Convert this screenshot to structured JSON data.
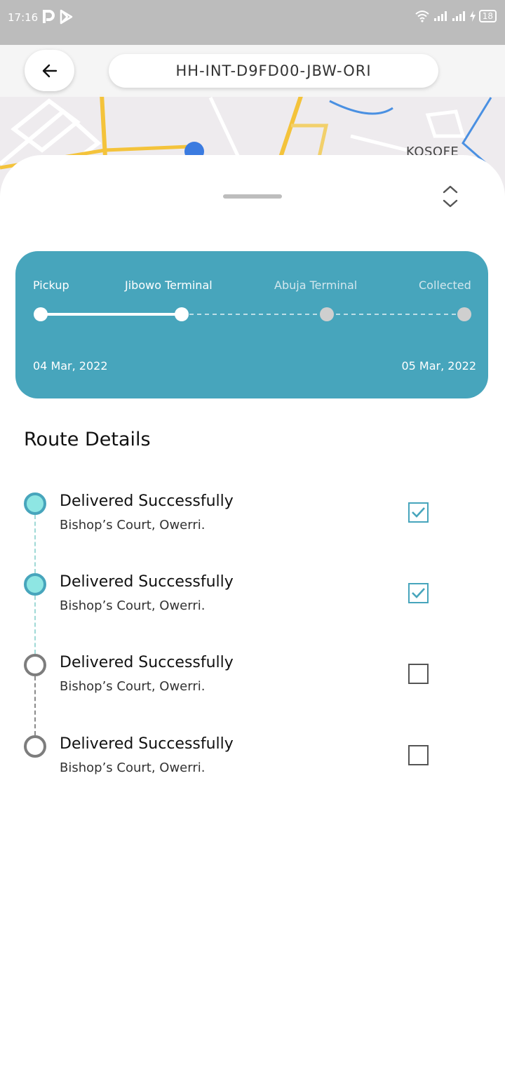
{
  "status_bar": {
    "time": "17:16",
    "battery": "18",
    "app_icons": [
      "p-app-icon",
      "play-store-icon"
    ],
    "system_icons": [
      "wifi-icon",
      "signal-icon",
      "signal-icon",
      "charging-icon"
    ]
  },
  "map": {
    "area_label": "KOSOFE"
  },
  "header": {
    "back_icon": "arrow-left-icon",
    "tracking_id": "HH-INT-D9FD00-JBW-ORI"
  },
  "progress": {
    "accent_color": "#47a5bc",
    "stages": [
      {
        "label": "Pickup",
        "reached": true
      },
      {
        "label": "Jibowo Terminal",
        "reached": true
      },
      {
        "label": "Abuja Terminal",
        "reached": false
      },
      {
        "label": "Collected",
        "reached": false
      }
    ],
    "start_date": "04 Mar, 2022",
    "end_date": "05 Mar, 2022"
  },
  "route": {
    "title": "Route Details",
    "items": [
      {
        "status": "Delivered Successfully",
        "location": "Bishop’s Court, Owerri.",
        "checked": true
      },
      {
        "status": "Delivered Successfully",
        "location": "Bishop’s Court, Owerri.",
        "checked": true
      },
      {
        "status": "Delivered Successfully",
        "location": "Bishop’s Court, Owerri.",
        "checked": false
      },
      {
        "status": "Delivered Successfully",
        "location": "Bishop’s Court, Owerri.",
        "checked": false
      }
    ]
  }
}
